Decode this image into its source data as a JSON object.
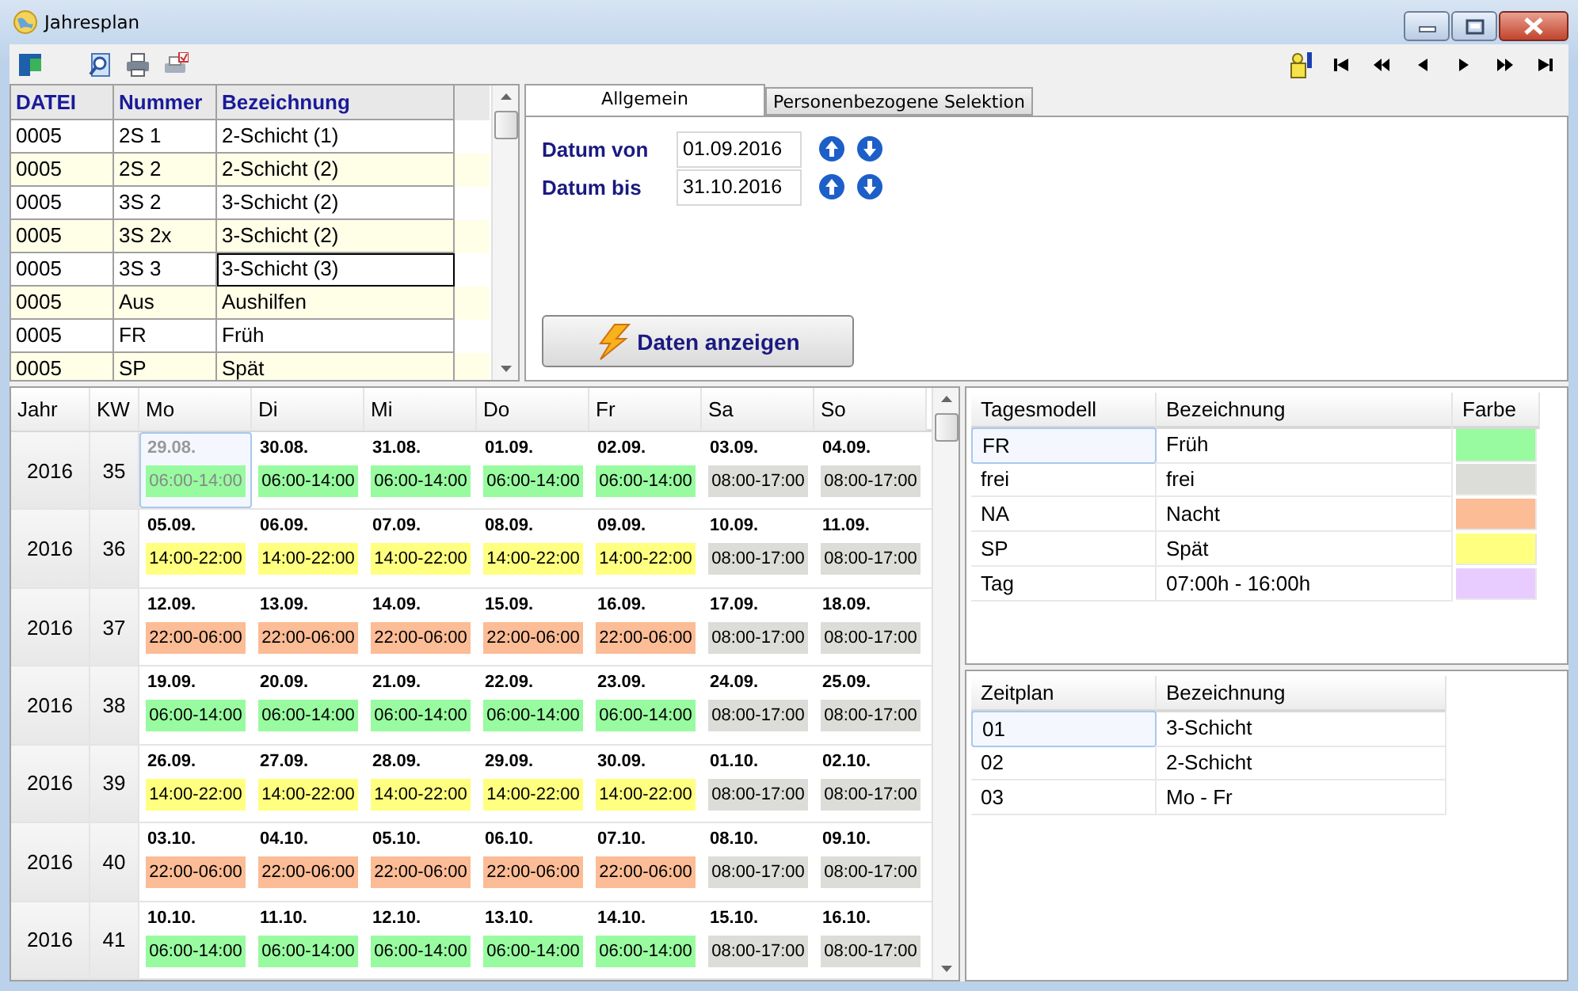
{
  "window": {
    "title": "Jahresplan"
  },
  "files_table": {
    "columns": [
      "DATEI",
      "Nummer",
      "Bezeichnung"
    ],
    "rows": [
      {
        "datei": "0005",
        "nummer": "2S 1",
        "bezeichnung": "2-Schicht (1)",
        "selected": false
      },
      {
        "datei": "0005",
        "nummer": "2S 2",
        "bezeichnung": "2-Schicht (2)",
        "selected": false
      },
      {
        "datei": "0005",
        "nummer": "3S 2",
        "bezeichnung": "3-Schicht (2)",
        "selected": false
      },
      {
        "datei": "0005",
        "nummer": "3S 2x",
        "bezeichnung": "3-Schicht (2)",
        "selected": false
      },
      {
        "datei": "0005",
        "nummer": "3S 3",
        "bezeichnung": "3-Schicht (3)",
        "selected": true
      },
      {
        "datei": "0005",
        "nummer": "Aus",
        "bezeichnung": "Aushilfen",
        "selected": false
      },
      {
        "datei": "0005",
        "nummer": "FR",
        "bezeichnung": "Früh",
        "selected": false
      },
      {
        "datei": "0005",
        "nummer": "SP",
        "bezeichnung": "Spät",
        "selected": false
      }
    ]
  },
  "tabs": [
    {
      "label": "Allgemein",
      "selected": true
    },
    {
      "label": "Personenbezogene Selektion",
      "selected": false
    }
  ],
  "date_fields": [
    {
      "label": "Datum von",
      "value": "01.09.2016"
    },
    {
      "label": "Datum bis",
      "value": "31.10.2016"
    }
  ],
  "show_button": {
    "label": "Daten anzeigen"
  },
  "calendar": {
    "columns": [
      "Jahr",
      "KW",
      "Mo",
      "Di",
      "Mi",
      "Do",
      "Fr",
      "Sa",
      "So"
    ],
    "weeks": [
      {
        "year": "2016",
        "week": "35",
        "days": [
          {
            "date": "29.08.",
            "time": "06:00-14:00",
            "color": "#98fba0",
            "disabled": true,
            "selected": true
          },
          {
            "date": "30.08.",
            "time": "06:00-14:00",
            "color": "#98fba0",
            "disabled": false,
            "selected": false
          },
          {
            "date": "31.08.",
            "time": "06:00-14:00",
            "color": "#98fba0",
            "disabled": false,
            "selected": false
          },
          {
            "date": "01.09.",
            "time": "06:00-14:00",
            "color": "#98fba0",
            "disabled": false,
            "selected": false
          },
          {
            "date": "02.09.",
            "time": "06:00-14:00",
            "color": "#98fba0",
            "disabled": false,
            "selected": false
          },
          {
            "date": "03.09.",
            "time": "08:00-17:00",
            "color": "#dcdcd8",
            "disabled": false,
            "selected": false
          },
          {
            "date": "04.09.",
            "time": "08:00-17:00",
            "color": "#dcdcd8",
            "disabled": false,
            "selected": false
          }
        ]
      },
      {
        "year": "2016",
        "week": "36",
        "days": [
          {
            "date": "05.09.",
            "time": "14:00-22:00",
            "color": "#ffff80",
            "disabled": false,
            "selected": false
          },
          {
            "date": "06.09.",
            "time": "14:00-22:00",
            "color": "#ffff80",
            "disabled": false,
            "selected": false
          },
          {
            "date": "07.09.",
            "time": "14:00-22:00",
            "color": "#ffff80",
            "disabled": false,
            "selected": false
          },
          {
            "date": "08.09.",
            "time": "14:00-22:00",
            "color": "#ffff80",
            "disabled": false,
            "selected": false
          },
          {
            "date": "09.09.",
            "time": "14:00-22:00",
            "color": "#ffff80",
            "disabled": false,
            "selected": false
          },
          {
            "date": "10.09.",
            "time": "08:00-17:00",
            "color": "#dcdcd8",
            "disabled": false,
            "selected": false
          },
          {
            "date": "11.09.",
            "time": "08:00-17:00",
            "color": "#dcdcd8",
            "disabled": false,
            "selected": false
          }
        ]
      },
      {
        "year": "2016",
        "week": "37",
        "days": [
          {
            "date": "12.09.",
            "time": "22:00-06:00",
            "color": "#fbbc96",
            "disabled": false,
            "selected": false
          },
          {
            "date": "13.09.",
            "time": "22:00-06:00",
            "color": "#fbbc96",
            "disabled": false,
            "selected": false
          },
          {
            "date": "14.09.",
            "time": "22:00-06:00",
            "color": "#fbbc96",
            "disabled": false,
            "selected": false
          },
          {
            "date": "15.09.",
            "time": "22:00-06:00",
            "color": "#fbbc96",
            "disabled": false,
            "selected": false
          },
          {
            "date": "16.09.",
            "time": "22:00-06:00",
            "color": "#fbbc96",
            "disabled": false,
            "selected": false
          },
          {
            "date": "17.09.",
            "time": "08:00-17:00",
            "color": "#dcdcd8",
            "disabled": false,
            "selected": false
          },
          {
            "date": "18.09.",
            "time": "08:00-17:00",
            "color": "#dcdcd8",
            "disabled": false,
            "selected": false
          }
        ]
      },
      {
        "year": "2016",
        "week": "38",
        "days": [
          {
            "date": "19.09.",
            "time": "06:00-14:00",
            "color": "#98fba0",
            "disabled": false,
            "selected": false
          },
          {
            "date": "20.09.",
            "time": "06:00-14:00",
            "color": "#98fba0",
            "disabled": false,
            "selected": false
          },
          {
            "date": "21.09.",
            "time": "06:00-14:00",
            "color": "#98fba0",
            "disabled": false,
            "selected": false
          },
          {
            "date": "22.09.",
            "time": "06:00-14:00",
            "color": "#98fba0",
            "disabled": false,
            "selected": false
          },
          {
            "date": "23.09.",
            "time": "06:00-14:00",
            "color": "#98fba0",
            "disabled": false,
            "selected": false
          },
          {
            "date": "24.09.",
            "time": "08:00-17:00",
            "color": "#dcdcd8",
            "disabled": false,
            "selected": false
          },
          {
            "date": "25.09.",
            "time": "08:00-17:00",
            "color": "#dcdcd8",
            "disabled": false,
            "selected": false
          }
        ]
      },
      {
        "year": "2016",
        "week": "39",
        "days": [
          {
            "date": "26.09.",
            "time": "14:00-22:00",
            "color": "#ffff80",
            "disabled": false,
            "selected": false
          },
          {
            "date": "27.09.",
            "time": "14:00-22:00",
            "color": "#ffff80",
            "disabled": false,
            "selected": false
          },
          {
            "date": "28.09.",
            "time": "14:00-22:00",
            "color": "#ffff80",
            "disabled": false,
            "selected": false
          },
          {
            "date": "29.09.",
            "time": "14:00-22:00",
            "color": "#ffff80",
            "disabled": false,
            "selected": false
          },
          {
            "date": "30.09.",
            "time": "14:00-22:00",
            "color": "#ffff80",
            "disabled": false,
            "selected": false
          },
          {
            "date": "01.10.",
            "time": "08:00-17:00",
            "color": "#dcdcd8",
            "disabled": false,
            "selected": false
          },
          {
            "date": "02.10.",
            "time": "08:00-17:00",
            "color": "#dcdcd8",
            "disabled": false,
            "selected": false
          }
        ]
      },
      {
        "year": "2016",
        "week": "40",
        "days": [
          {
            "date": "03.10.",
            "time": "22:00-06:00",
            "color": "#fbbc96",
            "disabled": false,
            "selected": false
          },
          {
            "date": "04.10.",
            "time": "22:00-06:00",
            "color": "#fbbc96",
            "disabled": false,
            "selected": false
          },
          {
            "date": "05.10.",
            "time": "22:00-06:00",
            "color": "#fbbc96",
            "disabled": false,
            "selected": false
          },
          {
            "date": "06.10.",
            "time": "22:00-06:00",
            "color": "#fbbc96",
            "disabled": false,
            "selected": false
          },
          {
            "date": "07.10.",
            "time": "22:00-06:00",
            "color": "#fbbc96",
            "disabled": false,
            "selected": false
          },
          {
            "date": "08.10.",
            "time": "08:00-17:00",
            "color": "#dcdcd8",
            "disabled": false,
            "selected": false
          },
          {
            "date": "09.10.",
            "time": "08:00-17:00",
            "color": "#dcdcd8",
            "disabled": false,
            "selected": false
          }
        ]
      },
      {
        "year": "2016",
        "week": "41",
        "days": [
          {
            "date": "10.10.",
            "time": "06:00-14:00",
            "color": "#98fba0",
            "disabled": false,
            "selected": false
          },
          {
            "date": "11.10.",
            "time": "06:00-14:00",
            "color": "#98fba0",
            "disabled": false,
            "selected": false
          },
          {
            "date": "12.10.",
            "time": "06:00-14:00",
            "color": "#98fba0",
            "disabled": false,
            "selected": false
          },
          {
            "date": "13.10.",
            "time": "06:00-14:00",
            "color": "#98fba0",
            "disabled": false,
            "selected": false
          },
          {
            "date": "14.10.",
            "time": "06:00-14:00",
            "color": "#98fba0",
            "disabled": false,
            "selected": false
          },
          {
            "date": "15.10.",
            "time": "08:00-17:00",
            "color": "#dcdcd8",
            "disabled": false,
            "selected": false
          },
          {
            "date": "16.10.",
            "time": "08:00-17:00",
            "color": "#dcdcd8",
            "disabled": false,
            "selected": false
          }
        ]
      }
    ]
  },
  "day_models": {
    "columns": [
      "Tagesmodell",
      "Bezeichnung",
      "Farbe"
    ],
    "rows": [
      {
        "code": "FR",
        "name": "Früh",
        "color": "#98fba0",
        "selected": true
      },
      {
        "code": "frei",
        "name": "frei",
        "color": "#dcdcd8",
        "selected": false
      },
      {
        "code": "NA",
        "name": "Nacht",
        "color": "#fbbc96",
        "selected": false
      },
      {
        "code": "SP",
        "name": "Spät",
        "color": "#ffff80",
        "selected": false
      },
      {
        "code": "Tag",
        "name": "07:00h - 16:00h",
        "color": "#e8ccff",
        "selected": false
      }
    ]
  },
  "schedules": {
    "columns": [
      "Zeitplan",
      "Bezeichnung"
    ],
    "rows": [
      {
        "code": "01",
        "name": "3-Schicht",
        "selected": true
      },
      {
        "code": "02",
        "name": "2-Schicht",
        "selected": false
      },
      {
        "code": "03",
        "name": "Mo - Fr",
        "selected": false
      }
    ]
  }
}
